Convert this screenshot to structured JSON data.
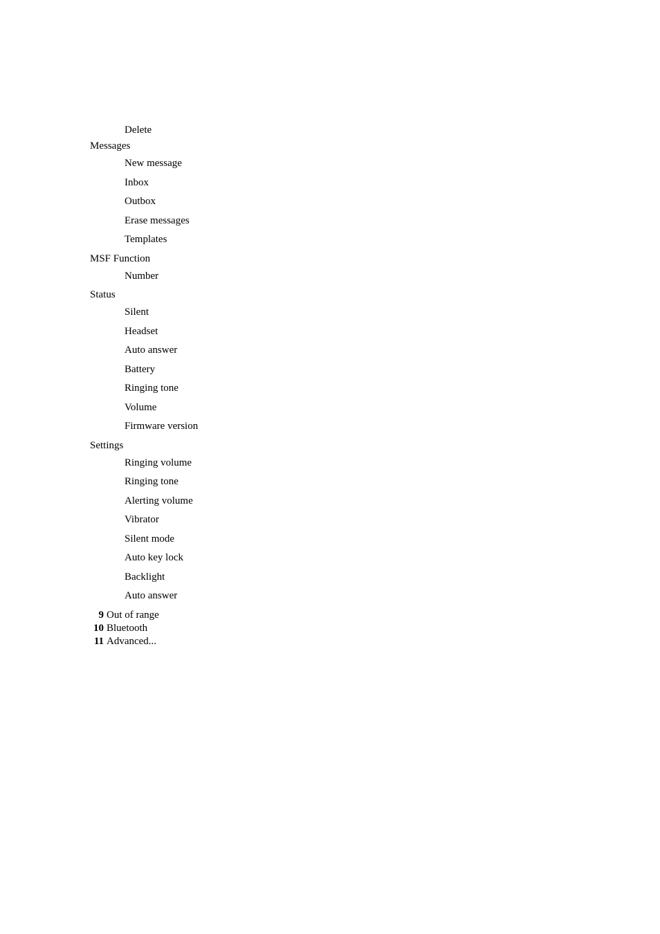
{
  "content": {
    "delete_label": "Delete",
    "sections": [
      {
        "heading": "Messages",
        "sub_items": [
          "New message",
          "Inbox",
          "Outbox",
          "Erase messages",
          "Templates"
        ]
      },
      {
        "heading": "MSF Function",
        "sub_items": [
          "Number"
        ]
      },
      {
        "heading": "Status",
        "sub_items": [
          "Silent",
          "Headset",
          "Auto answer",
          "Battery",
          "Ringing tone",
          "Volume",
          "Firmware version"
        ]
      },
      {
        "heading": "Settings",
        "sub_items": [
          "Ringing volume",
          "Ringing tone",
          "Alerting volume",
          "Vibrator",
          "Silent mode",
          "Auto key lock",
          "Backlight",
          "Auto answer"
        ]
      }
    ],
    "numbered_items": [
      {
        "num": "9",
        "label": "Out of range"
      },
      {
        "num": "10",
        "label": "Bluetooth"
      },
      {
        "num": "11",
        "label": "Advanced..."
      }
    ]
  }
}
